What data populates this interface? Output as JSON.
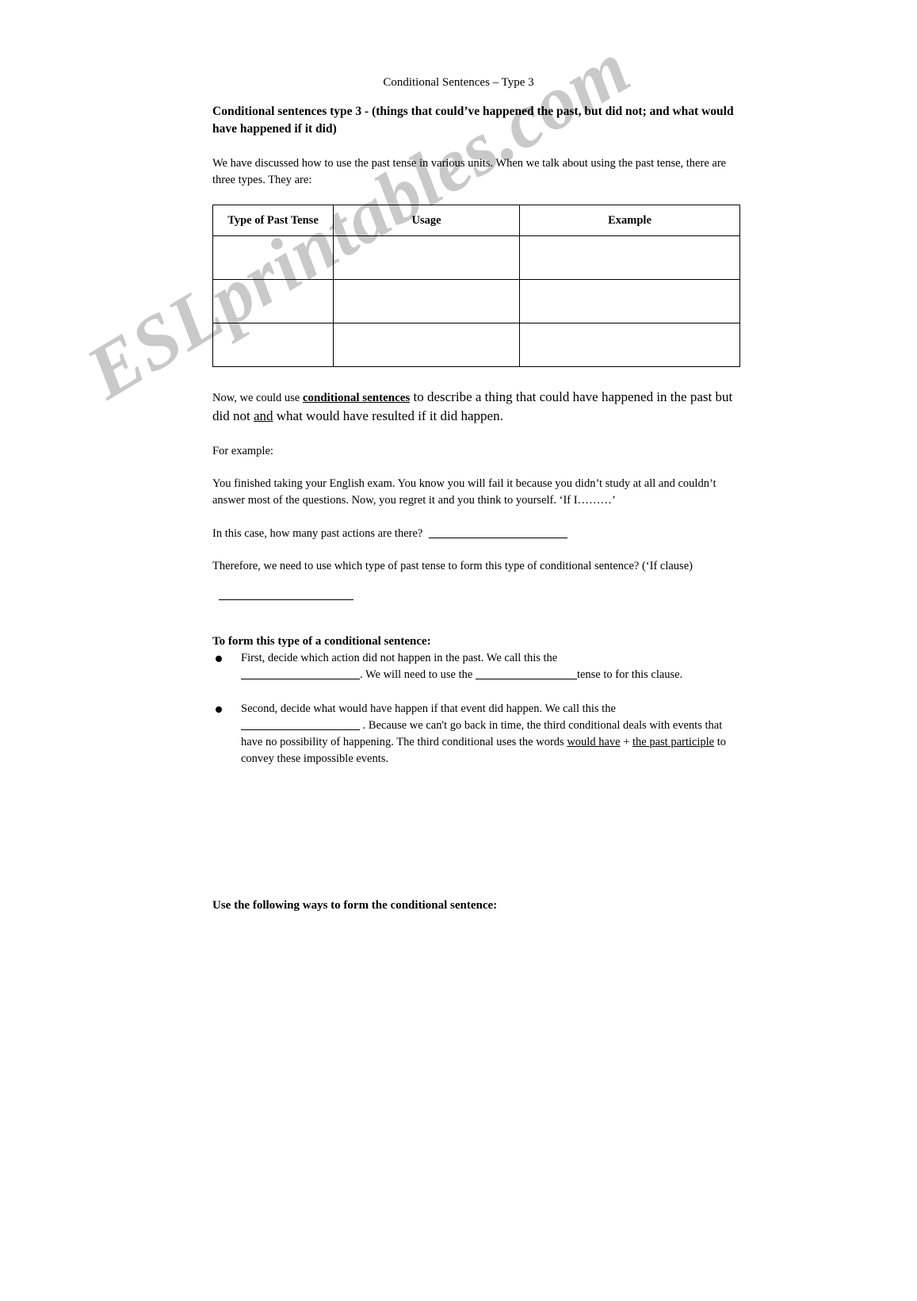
{
  "document": {
    "running_head": "Conditional Sentences – Type 3",
    "watermark": "ESLprintables.com",
    "title": "Conditional sentences type 3 - (things that could’ve happened the past, but did not; and what would have happened if it did)",
    "intro": "We have discussed how to use the past tense in various units. When we talk about using the past tense, there are three types. They are:",
    "table": {
      "headers": [
        "Type of Past Tense",
        "Usage",
        "Example"
      ],
      "rows": [
        [
          "",
          "",
          ""
        ],
        [
          "",
          "",
          ""
        ],
        [
          "",
          "",
          ""
        ]
      ]
    },
    "conditional_paragraph": {
      "lead": "Now, we could use ",
      "underlined_term": "conditional sentences",
      "middle": " to describe a thing that could have happened in the past but did not ",
      "underlined_and": "and",
      "tail": " what would have resulted if it did happen."
    },
    "for_example_label": "For example:",
    "example_text": "You finished taking your English exam.  You know you will fail it because you didn’t study at all and couldn’t answer most of the questions. Now, you regret it and you think to yourself.  ‘If I………’",
    "question_past_actions": " In this case, how many past actions are there?",
    "question_which_tense": "Therefore, we need to use which type of past tense to form this type of conditional sentence? (‘If clause)",
    "form_heading": "To form this type of a conditional sentence:",
    "bullets": [
      {
        "part1": "First, decide which action did not happen in the past. We call this the",
        "part2": ". We will need to use the",
        "part3": "tense to for this clause."
      },
      {
        "part1": "Second, decide what would have happen if that event did happen.  We call this the",
        "part2": ". Because we can't go back in time, the third conditional deals with events that have no possibility of happening. The third conditional uses the words ",
        "underline1": "would have",
        "plus": " + ",
        "underline2": "the past participle",
        "part3": " to convey these impossible events."
      }
    ],
    "closing_heading": "Use the following ways to form the conditional sentence:"
  }
}
